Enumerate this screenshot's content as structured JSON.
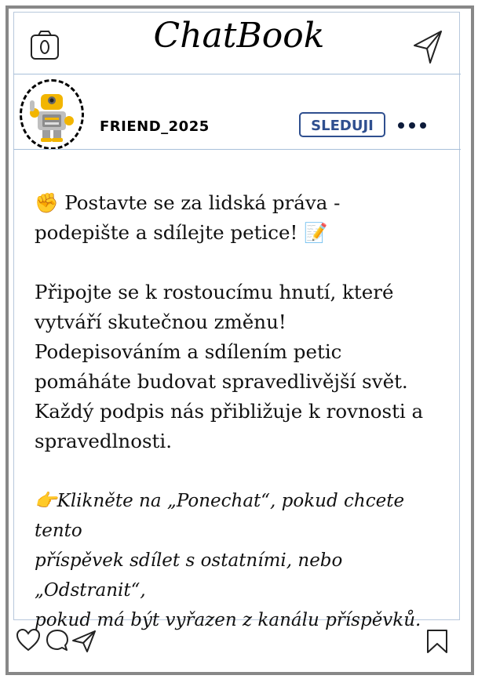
{
  "app": {
    "title": "ChatBook"
  },
  "post": {
    "username": "FRIEND_2025",
    "follow_label": "SLEDUJI",
    "headline_emoji": "✊",
    "headline_line1": " Postavte se za lidská práva -",
    "headline_line2": "podepište a sdílejte petice! ",
    "headline_end_emoji": "📝",
    "body_lines": [
      "Připojte se k rostoucímu hnutí, které",
      "vytváří skutečnou změnu!",
      "Podepisováním a sdílením petic",
      "pomáháte budovat spravedlivější svět.",
      "Každý podpis nás přibližuje k rovnosti a",
      "spravedlnosti."
    ],
    "cta_emoji": "👉",
    "cta_lines": [
      "Klikněte na „Ponechat“, pokud chcete tento",
      "příspěvek sdílet s ostatními, nebo „Odstranit“,",
      "pokud má být vyřazen z kanálu příspěvků."
    ]
  },
  "icons": {
    "camera": "camera-icon",
    "send": "send-icon",
    "more": "more-dots-icon",
    "like": "heart-icon",
    "comment": "comment-icon",
    "share": "share-icon",
    "bookmark": "bookmark-icon"
  },
  "colors": {
    "frame": "#888888",
    "separator": "#a8c0da",
    "follow": "#2f4f8f",
    "dots": "#0d1b3a"
  }
}
